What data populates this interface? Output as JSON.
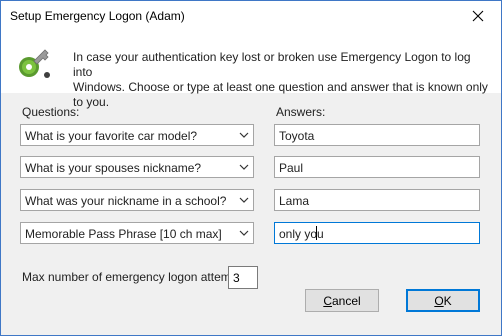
{
  "window": {
    "title": "Setup Emergency Logon (Adam)"
  },
  "header": {
    "intro_line1": "In case your authentication key lost or broken use Emergency Logon to log into",
    "intro_line2": "Windows. Choose or type at least one question and answer that is known only to you."
  },
  "labels": {
    "questions": "Questions:",
    "answers": "Answers:"
  },
  "questions": [
    {
      "question": "What is your favorite car model?",
      "answer": "Toyota"
    },
    {
      "question": "What is your spouses nickname?",
      "answer": "Paul"
    },
    {
      "question": "What was your nickname in a school?",
      "answer": "Lama"
    },
    {
      "question": "Memorable Pass Phrase [10 ch max]",
      "answer": "only you"
    }
  ],
  "attempts": {
    "label": "Max number of emergency logon attempts:",
    "value": "3"
  },
  "buttons": {
    "cancel": "Cancel",
    "ok": "OK"
  },
  "icons": {
    "close": "close-icon",
    "key": "key-icon",
    "dropdown": "chevron-down-icon"
  },
  "colors": {
    "accent": "#0078d7",
    "window_border": "#3f77c6",
    "dialog_bg": "#f0f0f0"
  }
}
